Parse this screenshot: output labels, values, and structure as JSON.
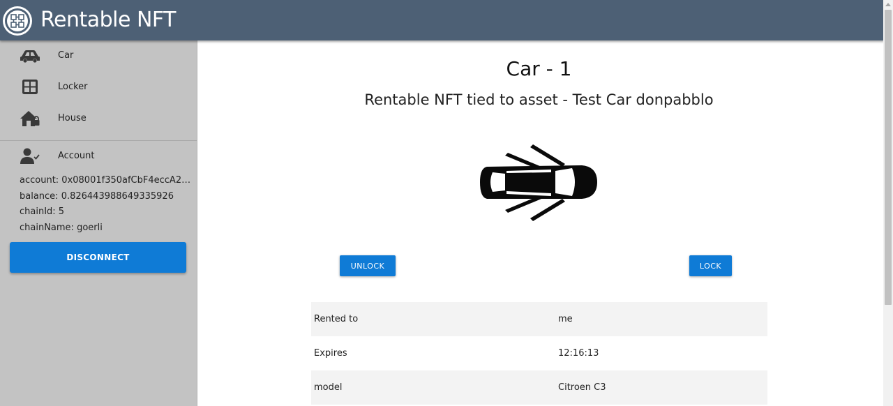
{
  "app": {
    "title": "Rentable NFT"
  },
  "sidebar": {
    "items": [
      {
        "label": "Car",
        "icon": "car-icon"
      },
      {
        "label": "Locker",
        "icon": "locker-icon"
      },
      {
        "label": "House",
        "icon": "house-lock-icon"
      }
    ],
    "account_section": {
      "label": "Account",
      "icon": "account-check-icon",
      "lines": [
        "account: 0x08001f350afCbF4eccA29...",
        "balance: 0.826443988649335926",
        "chainId: 5",
        "chainName: goerli"
      ]
    },
    "disconnect_label": "DISCONNECT"
  },
  "main": {
    "title": "Car - 1",
    "subtitle": "Rentable NFT tied to asset - Test Car donpabblo",
    "image_icon": "car-doors-open-icon",
    "unlock_label": "UNLOCK",
    "lock_label": "LOCK",
    "rows": [
      {
        "key": "Rented to",
        "value": "me"
      },
      {
        "key": "Expires",
        "value": "12:16:13"
      },
      {
        "key": "model",
        "value": "Citroen C3"
      }
    ]
  },
  "colors": {
    "appbar": "#4d6075",
    "sidebar": "#c3c3c3",
    "accent": "#0f7bd6"
  }
}
